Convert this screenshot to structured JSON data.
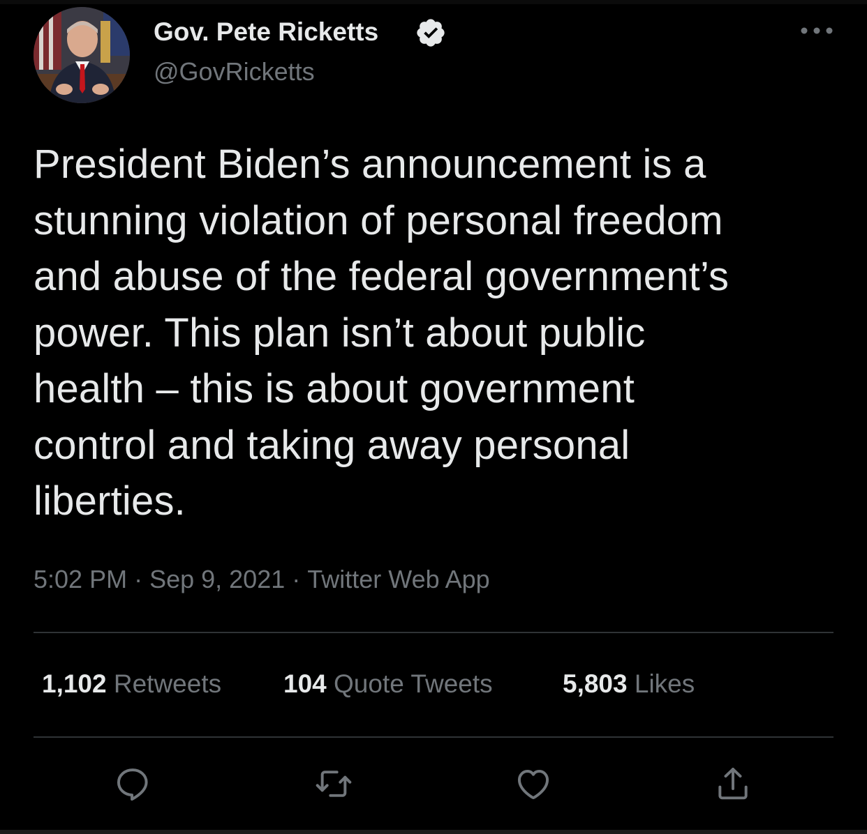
{
  "tweet": {
    "author": {
      "display_name": "Gov. Pete Ricketts",
      "handle": "@GovRicketts",
      "verified": true,
      "avatar": "avatar-photo"
    },
    "text": "President Biden’s announcement is a\nstunning violation of personal freedom\nand abuse of the federal government’s\npower. This plan isn’t about public\nhealth – this is about government\ncontrol and taking away personal\nliberties.",
    "meta": {
      "time": "5:02 PM",
      "date": "Sep 9, 2021",
      "source": "Twitter Web App",
      "separator": "·"
    },
    "stats": {
      "retweets": {
        "count": "1,102",
        "label": "Retweets"
      },
      "quote_tweets": {
        "count": "104",
        "label": "Quote Tweets"
      },
      "likes": {
        "count": "5,803",
        "label": "Likes"
      }
    },
    "actions": [
      {
        "name": "reply",
        "icon": "reply-icon"
      },
      {
        "name": "retweet",
        "icon": "retweet-icon"
      },
      {
        "name": "like",
        "icon": "heart-icon"
      },
      {
        "name": "share",
        "icon": "share-icon"
      }
    ]
  },
  "colors": {
    "background": "#000000",
    "primary_text": "#e7e9ea",
    "secondary_text": "#71767b",
    "divider": "#2f3336",
    "verified_badge": "#e7e9ea"
  }
}
